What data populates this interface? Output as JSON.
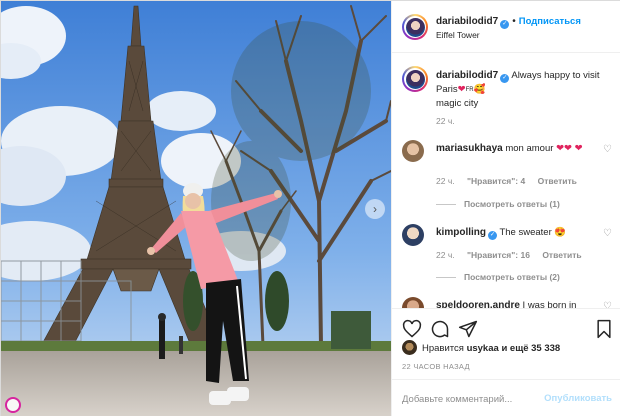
{
  "post": {
    "author": {
      "username": "dariabilodid7",
      "verified": true,
      "follow_label": "Подписаться",
      "location": "Eiffel Tower"
    },
    "caption": {
      "username": "dariabilodid7",
      "text": "Always happy to visit Paris",
      "emoji_1": "❤",
      "emoji_flag": "FR",
      "emoji_2": "🥰",
      "text_2": "magic city",
      "time": "22 ч."
    },
    "comments": [
      {
        "username": "mariasukhaya",
        "text": "mon amour",
        "emoji": "❤❤ ❤",
        "time": "22 ч.",
        "likes": "\"Нравится\": 4",
        "reply_label": "Ответить",
        "view_replies": "Посмотреть ответы (1)"
      },
      {
        "username": "kimpolling",
        "verified": true,
        "text": "The sweater",
        "emoji": "😍",
        "time": "22 ч.",
        "likes": "\"Нравится\": 16",
        "reply_label": "Ответить",
        "view_replies": "Посмотреть ответы (2)"
      },
      {
        "username": "speldooren.andre",
        "text": "I was born in"
      }
    ],
    "likes_summary": {
      "prefix": "Нравится",
      "user": "usykaa",
      "and_more": "и ещё 35 338"
    },
    "post_time": "22 ЧАСОВ НАЗАД",
    "add_comment": {
      "placeholder": "Добавьте комментарий...",
      "publish_label": "Опубликовать"
    },
    "icons": {
      "like": "heart-icon",
      "comment": "comment-icon",
      "share": "share-icon",
      "save": "bookmark-icon"
    },
    "colors": {
      "link_blue": "#0095f6",
      "verified_blue": "#3897f0",
      "muted_text": "#8e8e8e",
      "border": "#dbdbdb",
      "publish_disabled": "#b2dffc"
    }
  }
}
